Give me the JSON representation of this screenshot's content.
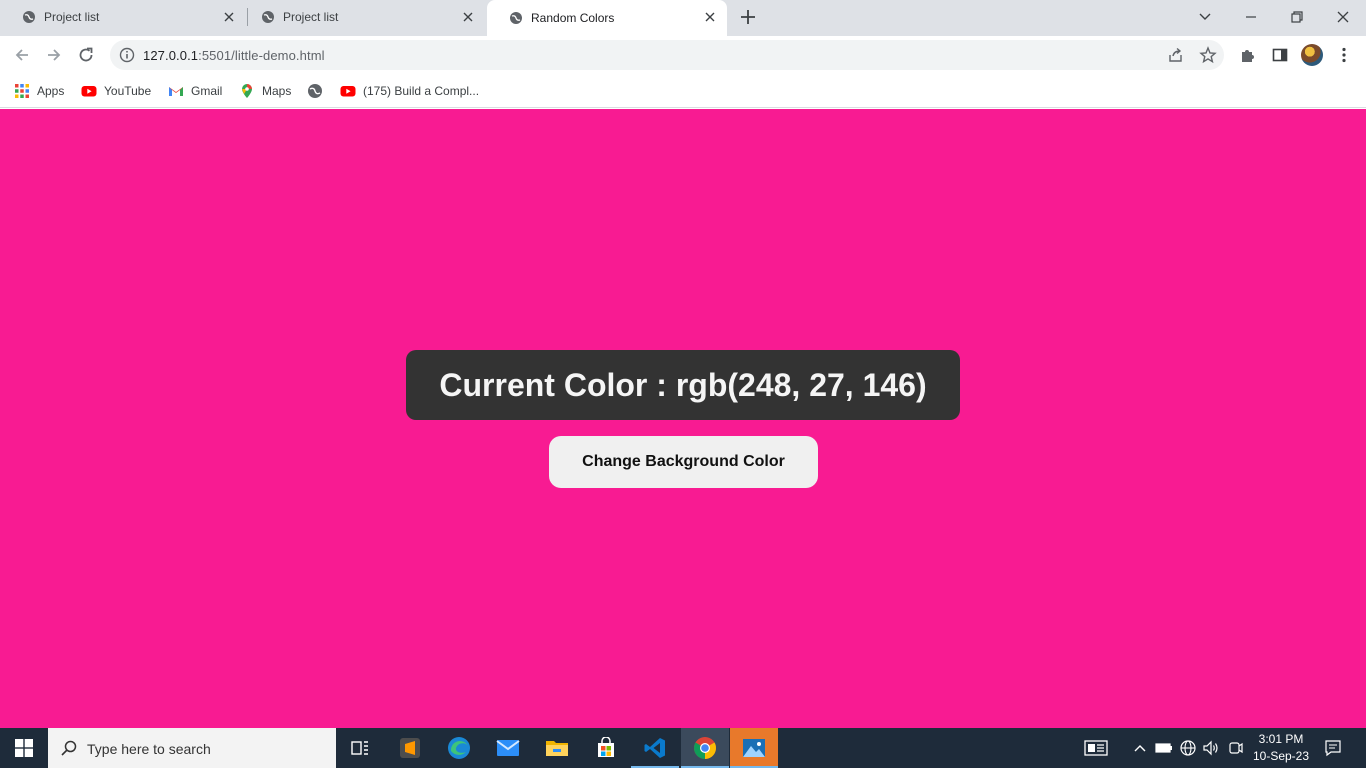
{
  "browser": {
    "tabs": [
      {
        "title": "Project list",
        "active": false
      },
      {
        "title": "Project list",
        "active": false
      },
      {
        "title": "Random Colors",
        "active": true
      }
    ],
    "url_host": "127.0.0.1",
    "url_path": ":5501/little-demo.html"
  },
  "bookmarks": [
    {
      "label": "Apps",
      "icon": "apps-grid-icon"
    },
    {
      "label": "YouTube",
      "icon": "youtube-icon"
    },
    {
      "label": "Gmail",
      "icon": "gmail-icon"
    },
    {
      "label": "Maps",
      "icon": "maps-pin-icon"
    },
    {
      "label": "",
      "icon": "globe-icon"
    },
    {
      "label": "(175) Build a Compl...",
      "icon": "youtube-icon"
    }
  ],
  "page": {
    "background_color": "#f81b92",
    "current_color_text": "Current Color : rgb(248, 27, 146)",
    "button_label": "Change Background Color"
  },
  "taskbar": {
    "search_placeholder": "Type here to search",
    "time": "3:01 PM",
    "date": "10-Sep-23",
    "apps": [
      "task-view",
      "sublime-text",
      "edge",
      "mail",
      "file-explorer",
      "store",
      "vscode",
      "chrome",
      "photos"
    ]
  }
}
